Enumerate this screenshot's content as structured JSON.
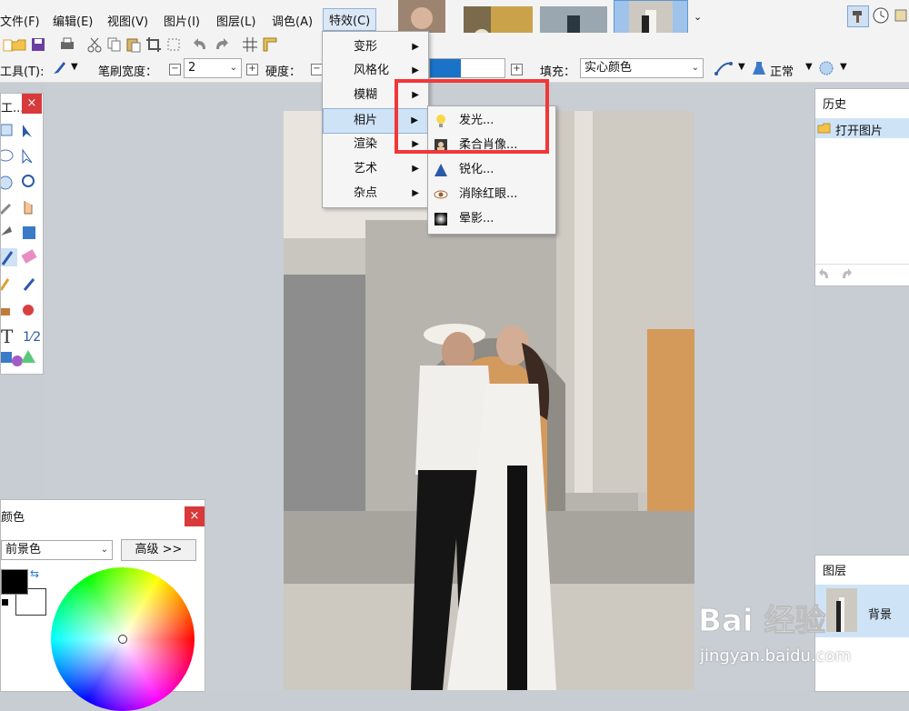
{
  "menubar": {
    "items": [
      "文件(F)",
      "编辑(E)",
      "视图(V)",
      "图片(I)",
      "图层(L)",
      "调色(A)",
      "特效(C)"
    ]
  },
  "optbar": {
    "tool_label": "工具(T):",
    "brush_width_label": "笔刷宽度：",
    "brush_width_value": "2",
    "hardness_label": "硬度：",
    "fill_label": "填充：",
    "fill_value": "实心颜色",
    "blend_value": "正常"
  },
  "tools_panel": {
    "title": "工..."
  },
  "effects_menu": {
    "items": [
      "变形",
      "风格化",
      "模糊",
      "相片",
      "渲染",
      "艺术",
      "杂点"
    ],
    "highlighted": "相片"
  },
  "photo_submenu": {
    "items": [
      "发光...",
      "柔合肖像...",
      "锐化...",
      "消除红眼...",
      "晕影..."
    ],
    "icons": [
      "bulb-icon",
      "portrait-icon",
      "sharpen-icon",
      "eye-icon",
      "vignette-icon"
    ]
  },
  "history_panel": {
    "title": "历史",
    "entries": [
      "打开图片"
    ]
  },
  "layers_panel": {
    "title": "图层",
    "layers": [
      "背景"
    ]
  },
  "color_panel": {
    "title": "颜色",
    "mode": "前景色",
    "advanced_button": "高级 >>"
  },
  "watermark": {
    "logo": "Bai 经验",
    "url": "jingyan.baidu.com"
  },
  "colors": {
    "highlight_box": "#f03838",
    "primary": "#000000",
    "secondary": "#ffffff",
    "accent_blue": "#1a73c8"
  }
}
